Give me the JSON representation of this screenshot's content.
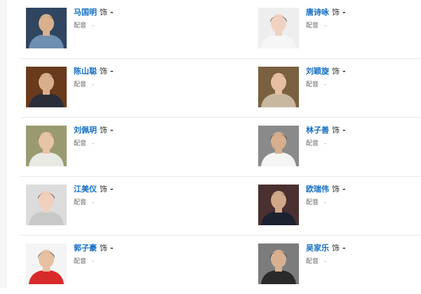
{
  "labels": {
    "role_suffix": "饰",
    "voice_label": "配音"
  },
  "colors": {
    "link": "#136ec2",
    "divider": "#e8e8e8"
  },
  "cast": [
    {
      "name": "马国明",
      "role": "-",
      "voice": "-",
      "bg": "#2f4560",
      "skin": "#d8b08c",
      "shirt": "#6f8fb0",
      "hair": "#1a1410"
    },
    {
      "name": "唐诗咏",
      "role": "-",
      "voice": "-",
      "bg": "#eeeeee",
      "skin": "#f0d2c0",
      "shirt": "#f6f6f6",
      "hair": "#2a1c16"
    },
    {
      "name": "陈山聪",
      "role": "-",
      "voice": "-",
      "bg": "#6a3a1c",
      "skin": "#d9ae8c",
      "shirt": "#2a2e3a",
      "hair": "#1c140e"
    },
    {
      "name": "刘颖旋",
      "role": "-",
      "voice": "-",
      "bg": "#7a6040",
      "skin": "#e6bfa0",
      "shirt": "#c8b8a0",
      "hair": "#5a3420"
    },
    {
      "name": "刘佩玥",
      "role": "-",
      "voice": "-",
      "bg": "#9a9a70",
      "skin": "#e8c4a6",
      "shirt": "#e9e9e4",
      "hair": "#8a5530"
    },
    {
      "name": "林子善",
      "role": "-",
      "voice": "-",
      "bg": "#8a8a8a",
      "skin": "#d8ae8c",
      "shirt": "#f4f4f4",
      "hair": "#222222"
    },
    {
      "name": "江美仪",
      "role": "-",
      "voice": "-",
      "bg": "#dcdcdc",
      "skin": "#f0d0bc",
      "shirt": "#c8c8c8",
      "hair": "#1a1412"
    },
    {
      "name": "欧瑞伟",
      "role": "-",
      "voice": "-",
      "bg": "#4a3030",
      "skin": "#d0a888",
      "shirt": "#1c2230",
      "hair": "#151010"
    },
    {
      "name": "郭子豪",
      "role": "-",
      "voice": "-",
      "bg": "#f4f4f4",
      "skin": "#e6c0a0",
      "shirt": "#d82a2a",
      "hair": "#141010"
    },
    {
      "name": "吴家乐",
      "role": "-",
      "voice": "-",
      "bg": "#7c7c7c",
      "skin": "#d8b090",
      "shirt": "#2a2a2a",
      "hair": "#161212"
    }
  ]
}
